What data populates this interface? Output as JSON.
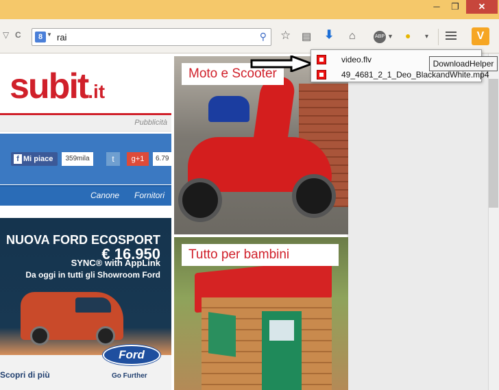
{
  "window": {
    "minimize_glyph": "─",
    "maximize_glyph": "❐",
    "close_glyph": "✕"
  },
  "toolbar": {
    "search_engine_glyph": "8",
    "search_value": "rai",
    "back_glyph": "▽",
    "reload_glyph": "C",
    "search_submit_glyph": "⚲",
    "icons": [
      "star-icon",
      "reading-list-icon",
      "download-icon",
      "home-icon",
      "adblock-icon",
      "downloadhelper-icon"
    ],
    "adblock_label": "ABP",
    "menu_dropdown_glyph": "▾",
    "extension_label": "V"
  },
  "downloads": {
    "items": [
      {
        "name": "video.flv"
      },
      {
        "name": "49_4681_2_1_Deo_BlackandWhite.mp4"
      }
    ],
    "tooltip": "DownloadHelper"
  },
  "left_page": {
    "logo_main": "subit",
    "logo_suffix": ".it",
    "sponsored": "Pubblicità",
    "facebook_label": "Mi piace",
    "facebook_count": "359mila",
    "twitter_glyph": "t",
    "googleplus_label": "g+1",
    "googleplus_count": "6.79",
    "nav_items": [
      "Canone",
      "Fornitori"
    ],
    "ford_ad": {
      "line1": "NUOVA FORD ECOSPORT",
      "line2": "€ 16.950",
      "line3": "SYNC® with AppLink",
      "line4": "Da oggi in tutti gli Showroom Ford",
      "logo": "Ford",
      "cta": "Scopri di più",
      "tagline": "Go Further"
    }
  },
  "cards": [
    {
      "label": "Moto e Scooter"
    },
    {
      "label": "Tutto per bambini"
    }
  ],
  "colors": {
    "accent": "#d0202a",
    "titlebar": "#f5c86a",
    "download_blue": "#1d6fd6"
  }
}
